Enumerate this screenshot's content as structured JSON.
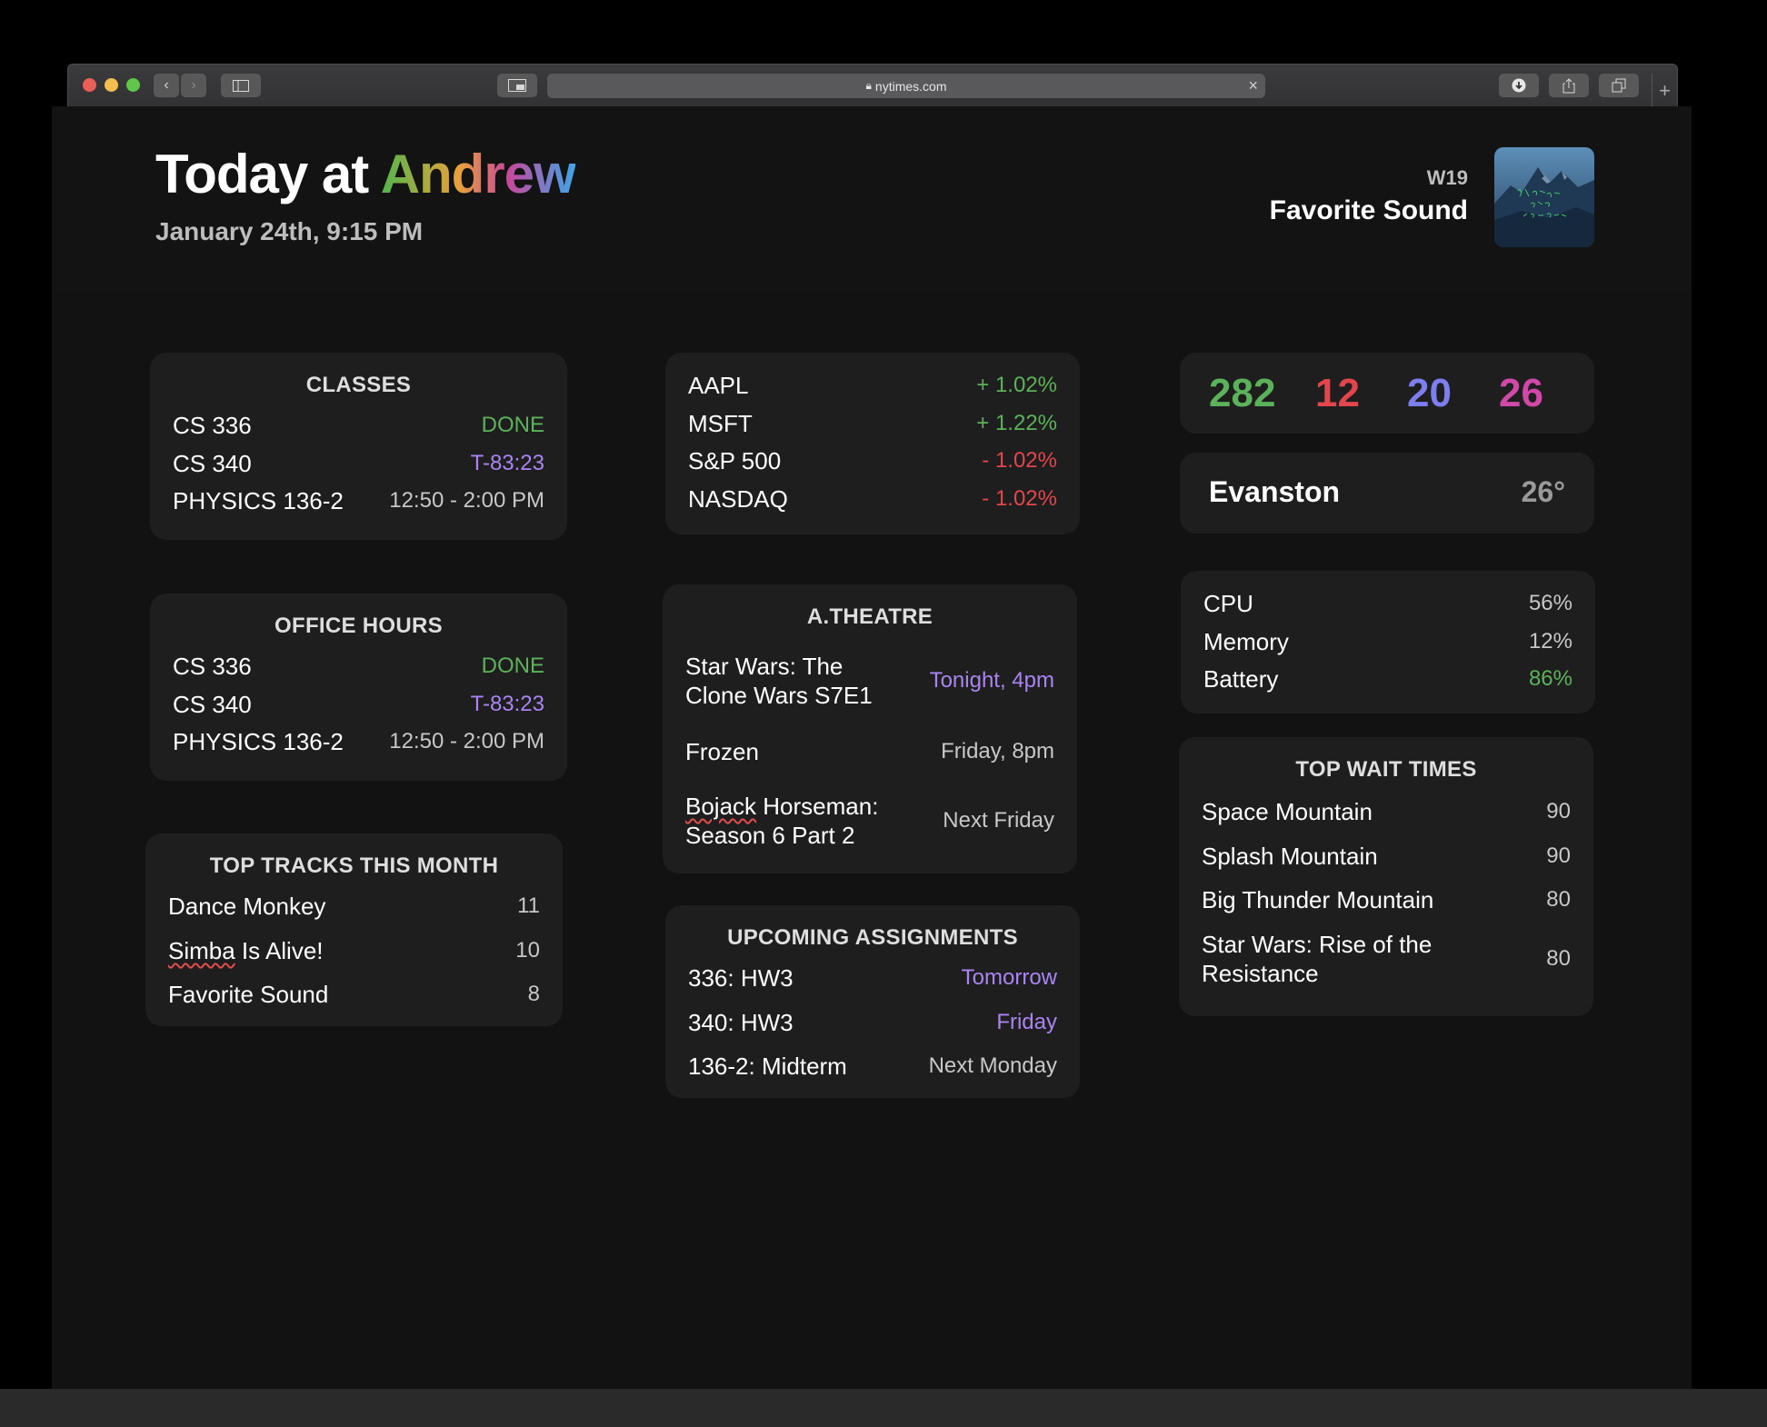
{
  "browser": {
    "url": "nytimes.com",
    "new_tab": "+",
    "url_clear": "×"
  },
  "header": {
    "title_prefix": "Today at ",
    "title_name": "Andrew",
    "date": "January 24th, 9:15 PM",
    "now_playing": {
      "week": "W19",
      "track": "Favorite Sound"
    }
  },
  "classes": {
    "title": "CLASSES",
    "rows": [
      {
        "label": "CS 336",
        "value": "DONE"
      },
      {
        "label": "CS 340",
        "value": "T-83:23"
      },
      {
        "label": "PHYSICS 136-2",
        "value": "12:50 - 2:00 PM"
      }
    ]
  },
  "office_hours": {
    "title": "OFFICE HOURS",
    "rows": [
      {
        "label": "CS 336",
        "value": "DONE"
      },
      {
        "label": "CS 340",
        "value": "T-83:23"
      },
      {
        "label": "PHYSICS 136-2",
        "value": "12:50 - 2:00 PM"
      }
    ]
  },
  "top_tracks": {
    "title": "TOP TRACKS THIS MONTH",
    "rows": [
      {
        "label": "Dance Monkey",
        "value": "11"
      },
      {
        "label_pre": "",
        "label_squiggle": "Simba",
        "label_post": " Is Alive!",
        "value": "10"
      },
      {
        "label": "Favorite Sound",
        "value": "8"
      }
    ]
  },
  "stocks": {
    "rows": [
      {
        "label": "AAPL",
        "value": "+ 1.02%"
      },
      {
        "label": "MSFT",
        "value": "+ 1.22%"
      },
      {
        "label": "S&P 500",
        "value": "- 1.02%"
      },
      {
        "label": "NASDAQ",
        "value": "- 1.02%"
      }
    ]
  },
  "theatre": {
    "title": "A.THEATRE",
    "rows": [
      {
        "label": "Star Wars: The Clone Wars S7E1",
        "line1": "Star Wars: The",
        "line2": "Clone Wars S7E1",
        "value": "Tonight, 4pm"
      },
      {
        "label": "Frozen",
        "value": "Friday, 8pm"
      },
      {
        "squiggle": "Bojack",
        "line1_post": " Horseman:",
        "line2": "Season 6 Part 2",
        "value": "Next Friday"
      }
    ]
  },
  "assignments": {
    "title": "UPCOMING ASSIGNMENTS",
    "rows": [
      {
        "label": "336: HW3",
        "value": "Tomorrow"
      },
      {
        "label": "340: HW3",
        "value": "Friday"
      },
      {
        "label": "136-2: Midterm",
        "value": "Next Monday"
      }
    ]
  },
  "counters": {
    "values": [
      "282",
      "12",
      "20",
      "26"
    ],
    "colors": [
      "#5cb25a",
      "#e2464d",
      "#7d7ef0",
      "#d149a8"
    ]
  },
  "weather": {
    "city": "Evanston",
    "temp": "26°"
  },
  "system": {
    "rows": [
      {
        "label": "CPU",
        "value": "56%"
      },
      {
        "label": "Memory",
        "value": "12%"
      },
      {
        "label": "Battery",
        "value": "86%"
      }
    ]
  },
  "wait_times": {
    "title": "TOP WAIT TIMES",
    "rows": [
      {
        "label": "Space Mountain",
        "value": "90"
      },
      {
        "label": "Splash Mountain",
        "value": "90"
      },
      {
        "label": "Big Thunder Mountain",
        "value": "80"
      },
      {
        "line1": "Star Wars: Rise of the",
        "line2": "Resistance",
        "value": "80"
      }
    ]
  },
  "colors": {
    "green": "#5cb25a",
    "purple": "#a984f2",
    "red": "#e2464d",
    "card_bg": "#1e1e1e",
    "page_bg": "#121212"
  }
}
